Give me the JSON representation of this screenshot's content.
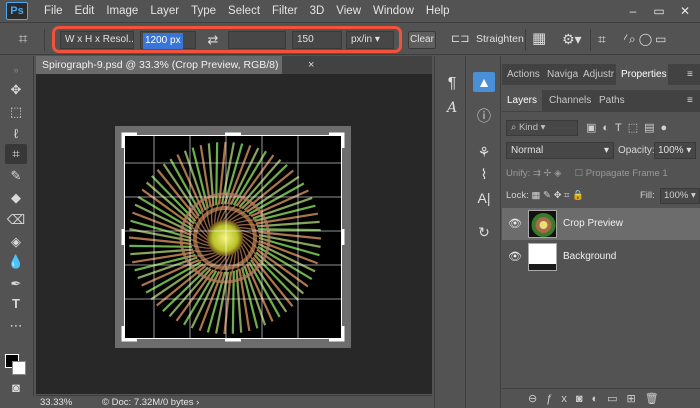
{
  "app": {
    "logo": "Ps"
  },
  "menu": [
    "File",
    "Edit",
    "Image",
    "Layer",
    "Type",
    "Select",
    "Filter",
    "3D",
    "View",
    "Window",
    "Help"
  ],
  "window_controls": {
    "minimize": "–",
    "restore": "▭",
    "close": "✕"
  },
  "options_bar": {
    "ratio_preset": "W x H x Resol...",
    "width_value": "1200 px",
    "height_value": "",
    "resolution_value": "150",
    "resolution_unit": "px/in",
    "clear_label": "Clear",
    "straighten_label": "Straighten",
    "highlight_color": "#f2513a"
  },
  "document": {
    "tab_title": "Spirograph-9.psd @ 33.3% (Crop Preview, RGB/8)",
    "tab_close": "×",
    "zoom": "33.33%",
    "doc_info": "Doc: 7.32M/0 bytes"
  },
  "panels": {
    "top_tabs": [
      "Actions",
      "Naviga",
      "Adjustr",
      "Properties"
    ],
    "active_top_tab": "Properties",
    "layer_tabs": [
      "Layers",
      "Channels",
      "Paths"
    ],
    "active_layer_tab": "Layers",
    "kind_filter": "Kind",
    "blend_mode": "Normal",
    "opacity_label": "Opacity:",
    "opacity_value": "100%",
    "unify_label": "Unify:",
    "propagate_label": "Propagate Frame 1",
    "lock_label": "Lock:",
    "fill_label": "Fill:",
    "fill_value": "100%",
    "layers": [
      {
        "name": "Crop Preview",
        "selected": true
      },
      {
        "name": "Background",
        "selected": false
      }
    ]
  },
  "colors": {
    "foreground": "#000000",
    "background": "#ffffff",
    "panel_bg": "#535353",
    "canvas_bg": "#282828",
    "accent": "#3875d7"
  }
}
